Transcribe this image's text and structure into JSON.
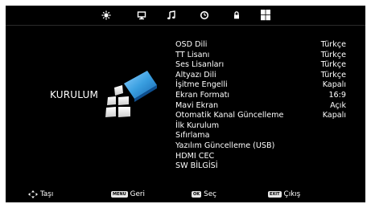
{
  "tabs": [
    {
      "icon": "picture-icon"
    },
    {
      "icon": "monitor-icon"
    },
    {
      "icon": "music-note-icon"
    },
    {
      "icon": "clock-icon"
    },
    {
      "icon": "lock-icon"
    },
    {
      "icon": "setup-grid-icon",
      "active": true
    }
  ],
  "section": {
    "title": "KURULUM"
  },
  "menu": [
    {
      "label": "OSD Dili",
      "value": "Türkçe"
    },
    {
      "label": "TT Lisanı",
      "value": "Türkçe"
    },
    {
      "label": "Ses Lisanları",
      "value": "Türkçe"
    },
    {
      "label": "Altyazı Dili",
      "value": "Türkçe"
    },
    {
      "label": "İşitme Engelli",
      "value": "Kapalı"
    },
    {
      "label": "Ekran Formatı",
      "value": "16:9"
    },
    {
      "label": "Mavi Ekran",
      "value": "Açık"
    },
    {
      "label": "Otomatik Kanal Güncelleme",
      "value": "Kapalı"
    },
    {
      "label": "İlk Kurulum",
      "value": ""
    },
    {
      "label": "Sıfırlama",
      "value": ""
    },
    {
      "label": "Yazılım Güncelleme (USB)",
      "value": ""
    },
    {
      "label": "HDMI CEC",
      "value": ""
    },
    {
      "label": "SW BİLGİSİ",
      "value": ""
    }
  ],
  "hints": {
    "move": {
      "label": "Taşı",
      "icon": "arrows-icon"
    },
    "back": {
      "key": "MENU",
      "label": "Geri"
    },
    "select": {
      "key": "OK",
      "label": "Seç"
    },
    "exit": {
      "key": "EXIT",
      "label": "Çıkış"
    }
  },
  "colors": {
    "background": "#000000",
    "text": "#ffffff",
    "accent": "#3a9fe0"
  }
}
